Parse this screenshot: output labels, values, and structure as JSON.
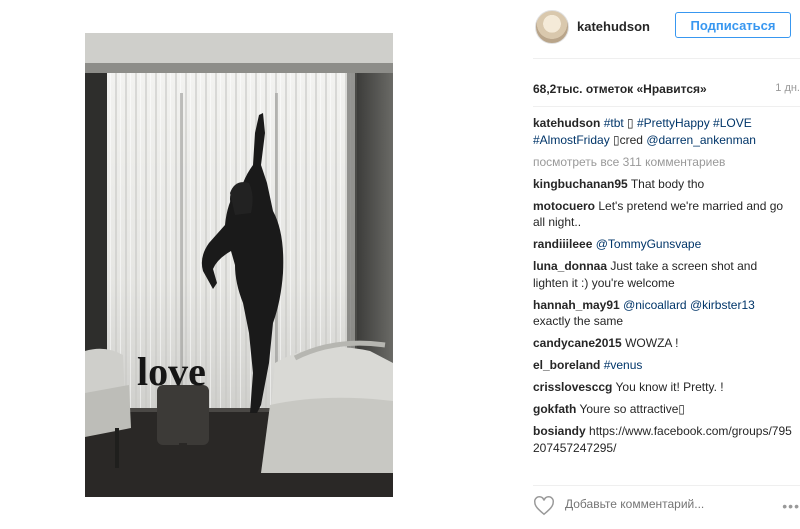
{
  "post": {
    "username": "katehudson",
    "follow_label": "Подписаться",
    "likes": "68,2тыс. отметок «Нравится»",
    "time": "1 дн.",
    "caption": {
      "user": "katehudson",
      "tag1": "#tbt",
      "sym1": "▯",
      "tag2": "#PrettyHappy",
      "tag3": "#LOVE",
      "tag4": "#AlmostFriday",
      "cred": "▯cred",
      "mention": "@darren_ankenman"
    },
    "view_all": "посмотреть все 311 комментариев",
    "add_comment_placeholder": "Добавьте комментарий...",
    "more_label": "•••",
    "photo_sign": "love"
  },
  "comments": [
    {
      "user": "kingbuchanan95",
      "text": "That body tho"
    },
    {
      "user": "motocuero",
      "text": "Let's pretend we're married and go all night.."
    },
    {
      "user": "randiiileee",
      "mention": "@TommyGunsvape"
    },
    {
      "user": "luna_donnaa",
      "text": "Just take a screen shot and lighten it :) you're welcome"
    },
    {
      "user": "hannah_may91",
      "mention1": "@nicoallard",
      "mention2": "@kirbster13",
      "text": "exactly the same"
    },
    {
      "user": "candycane2015",
      "text": "WOWZA !"
    },
    {
      "user": "el_boreland",
      "tag": "#venus"
    },
    {
      "user": "crisslovesccg",
      "text": "You know it! Pretty. !"
    },
    {
      "user": "gokfath",
      "text": "Youre so attractive▯"
    },
    {
      "user": "bosiandy",
      "text": "https://www.facebook.com/groups/795207457247295/"
    }
  ],
  "colors": {
    "accent": "#3897f0",
    "link": "#003569",
    "muted": "#999999"
  }
}
